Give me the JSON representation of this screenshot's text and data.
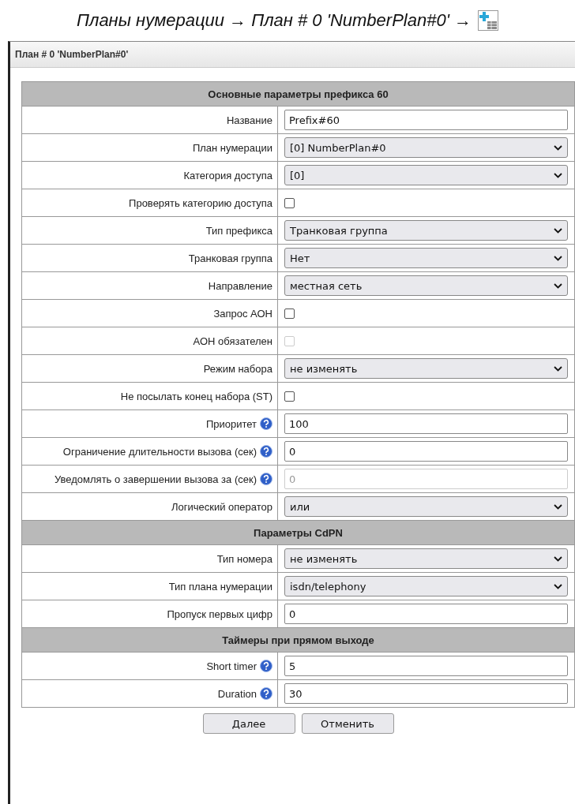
{
  "breadcrumb": {
    "path": "Планы нумерации → План # 0 'NumberPlan#0' →"
  },
  "window": {
    "title": "План # 0 'NumberPlan#0'"
  },
  "sections": [
    {
      "title": "Основные параметры префикса 60",
      "rows": [
        {
          "label": "Название",
          "kind": "text",
          "value": "Prefix#60",
          "help": false,
          "disabled": false
        },
        {
          "label": "План нумерации",
          "kind": "select",
          "value": "[0] NumberPlan#0",
          "help": false,
          "disabled": false
        },
        {
          "label": "Категория доступа",
          "kind": "select",
          "value": "[0]",
          "help": false,
          "disabled": false
        },
        {
          "label": "Проверять категорию доступа",
          "kind": "checkbox",
          "checked": false,
          "help": false,
          "disabled": false
        },
        {
          "label": "Тип префикса",
          "kind": "select",
          "value": "Транковая группа",
          "help": false,
          "disabled": false
        },
        {
          "label": "Транковая группа",
          "kind": "select",
          "value": "Нет",
          "help": false,
          "disabled": false
        },
        {
          "label": "Направление",
          "kind": "select",
          "value": "местная сеть",
          "help": false,
          "disabled": false
        },
        {
          "label": "Запрос АОН",
          "kind": "checkbox",
          "checked": false,
          "help": false,
          "disabled": false
        },
        {
          "label": "АОН обязателен",
          "kind": "checkbox",
          "checked": false,
          "help": false,
          "disabled": true
        },
        {
          "label": "Режим набора",
          "kind": "select",
          "value": "не изменять",
          "help": false,
          "disabled": false
        },
        {
          "label": "Не посылать конец набора (ST)",
          "kind": "checkbox",
          "checked": false,
          "help": false,
          "disabled": false
        },
        {
          "label": "Приоритет",
          "kind": "text",
          "value": "100",
          "help": true,
          "disabled": false
        },
        {
          "label": "Ограничение длительности вызова (сек)",
          "kind": "text",
          "value": "0",
          "help": true,
          "disabled": false
        },
        {
          "label": "Уведомлять о завершении вызова за (сек)",
          "kind": "text",
          "value": "0",
          "help": true,
          "disabled": true
        },
        {
          "label": "Логический оператор",
          "kind": "select",
          "value": "или",
          "help": false,
          "disabled": false
        }
      ]
    },
    {
      "title": "Параметры CdPN",
      "rows": [
        {
          "label": "Тип номера",
          "kind": "select",
          "value": "не изменять",
          "help": false,
          "disabled": false
        },
        {
          "label": "Тип плана нумерации",
          "kind": "select",
          "value": "isdn/telephony",
          "help": false,
          "disabled": false
        },
        {
          "label": "Пропуск первых цифр",
          "kind": "text",
          "value": "0",
          "help": false,
          "disabled": false
        }
      ]
    },
    {
      "title": "Таймеры при прямом выходе",
      "rows": [
        {
          "label": "Short timer",
          "kind": "text",
          "value": "5",
          "help": true,
          "disabled": false
        },
        {
          "label": "Duration",
          "kind": "text",
          "value": "30",
          "help": true,
          "disabled": false
        }
      ]
    }
  ],
  "buttons": [
    "Далее",
    "Отменить"
  ]
}
